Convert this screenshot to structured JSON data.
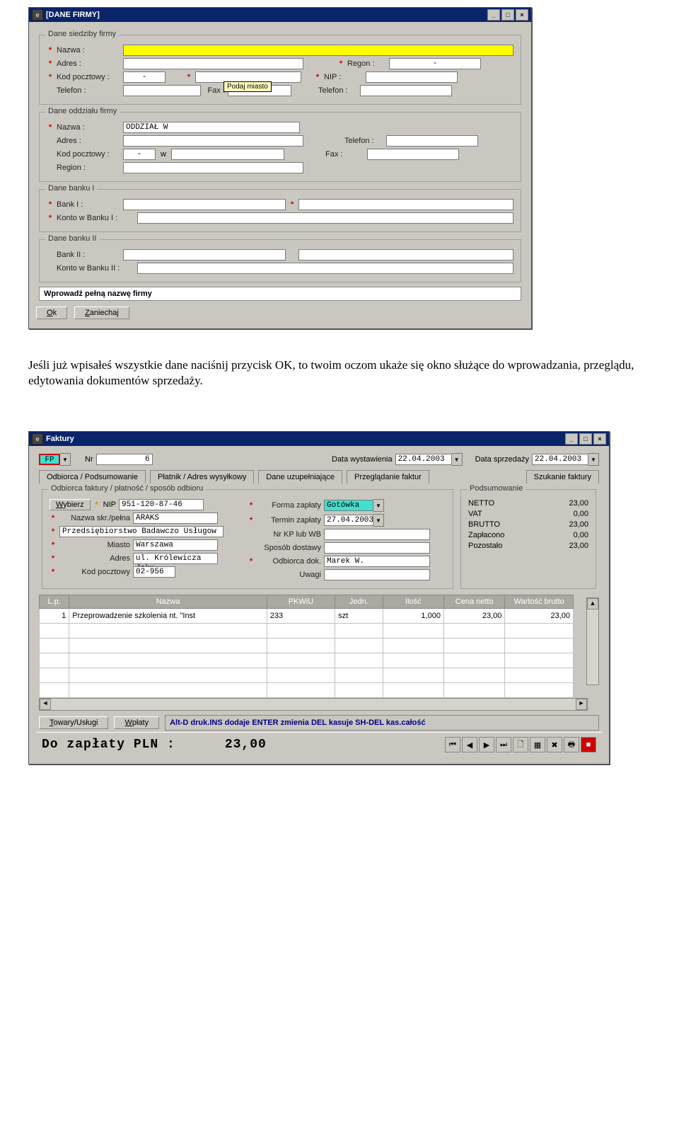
{
  "win1": {
    "title": "[DANE FIRMY]",
    "groups": {
      "siedziba": {
        "legend": "Dane siedziby firmy",
        "nazwa": "Nazwa :",
        "adres": "Adres :",
        "regon": "Regon :",
        "regon_val": "-",
        "kod": "Kod pocztowy :",
        "kod_val": "-",
        "nip": "NIP :",
        "telefon": "Telefon :",
        "fax": "Fax :",
        "telefon2": "Telefon :",
        "tooltip": "Podaj miasto"
      },
      "oddzial": {
        "legend": "Dane oddziału firmy",
        "nazwa": "Nazwa :",
        "nazwa_val": "ODDZIAŁ W",
        "adres": "Adres :",
        "telefon": "Telefon :",
        "kod": "Kod pocztowy :",
        "kod_dash": "-",
        "kod_w": "w",
        "fax": "Fax :",
        "region": "Region :"
      },
      "bank1": {
        "legend": "Dane banku I",
        "bank": "Bank I :",
        "konto": "Konto w Banku I :"
      },
      "bank2": {
        "legend": "Dane banku II",
        "bank": "Bank II :",
        "konto": "Konto w Banku II :"
      }
    },
    "status": "Wprowadź pełną nazwę firmy",
    "buttons": {
      "ok": "Ok",
      "cancel": "Zaniechaj"
    }
  },
  "paragraph": "Jeśli już wpisałeś wszystkie dane naciśnij przycisk OK, to twoim oczom ukaże się okno służące do wprowadzania, przeglądu, edytowania dokumentów sprzedaży.",
  "win2": {
    "title": "Faktury",
    "top": {
      "fp": "FP",
      "nr_label": "Nr",
      "nr_val": "6",
      "data_wyst_label": "Data wystawienia",
      "data_wyst_val": "22.04.2003",
      "data_sprz_label": "Data sprzedaży",
      "data_sprz_val": "22.04.2003"
    },
    "tabs": {
      "t1": "Odbiorca / Podsumowanie",
      "t2": "Płatnik / Adres wysyłkowy",
      "t3": "Dane uzupełniające",
      "t4": "Przeglądanie faktur",
      "t5": "Szukanie faktury"
    },
    "odbiorca_legend": "Odbiorca faktury / płatność / sposób odbioru",
    "podsum_legend": "Podsumowanie",
    "fields": {
      "wybierz": "Wybierz",
      "nip_lbl": "NIP",
      "nip_val": "951-120-87-46",
      "nazwa_lbl": "Nazwa skr./pełna",
      "nazwa_val": "ARAKS",
      "pelna_val": "Przedsiębiorstwo Badawczo Usługow",
      "miasto_lbl": "Miasto",
      "miasto_val": "Warszawa",
      "adres_lbl": "Adres",
      "adres_val": "ul. Królewicza Jaku",
      "kod_lbl": "Kod pocztowy",
      "kod_val": "02-956",
      "forma_lbl": "Forma zapłaty",
      "forma_val": "Gotówka",
      "termin_lbl": "Termin zapłaty",
      "termin_val": "27.04.2003",
      "nrkp_lbl": "Nr KP lub WB",
      "sposob_lbl": "Sposób dostawy",
      "odbdok_lbl": "Odbiorca dok.",
      "odbdok_val": "Marek W.",
      "uwagi_lbl": "Uwagi"
    },
    "summary": {
      "netto_l": "NETTO",
      "netto_v": "23,00",
      "vat_l": "VAT",
      "vat_v": "0,00",
      "brutto_l": "BRUTTO",
      "brutto_v": "23,00",
      "zap_l": "Zapłacono",
      "zap_v": "0,00",
      "poz_l": "Pozostało",
      "poz_v": "23,00"
    },
    "grid": {
      "headers": {
        "lp": "L.p.",
        "nazwa": "Nazwa",
        "pkwiu": "PKWiU",
        "jedn": "Jedn.",
        "ilosc": "Ilość",
        "cena": "Cena netto",
        "wart": "Wartość brutto"
      },
      "row1": {
        "lp": "1",
        "nazwa": "Przeprowadzenie szkolenia nt. \"Inst",
        "pkwiu": "233",
        "jedn": "szt",
        "ilosc": "1,000",
        "cena": "23,00",
        "wart": "23,00"
      }
    },
    "bottom": {
      "towary": "Towary/Usługi",
      "wplaty": "Wpłaty",
      "hint": "Alt-D druk.INS dodaje ENTER zmienia DEL kasuje SH-DEL kas.całość",
      "pay_label": "Do zapłaty PLN :",
      "pay_value": "23,00"
    }
  }
}
